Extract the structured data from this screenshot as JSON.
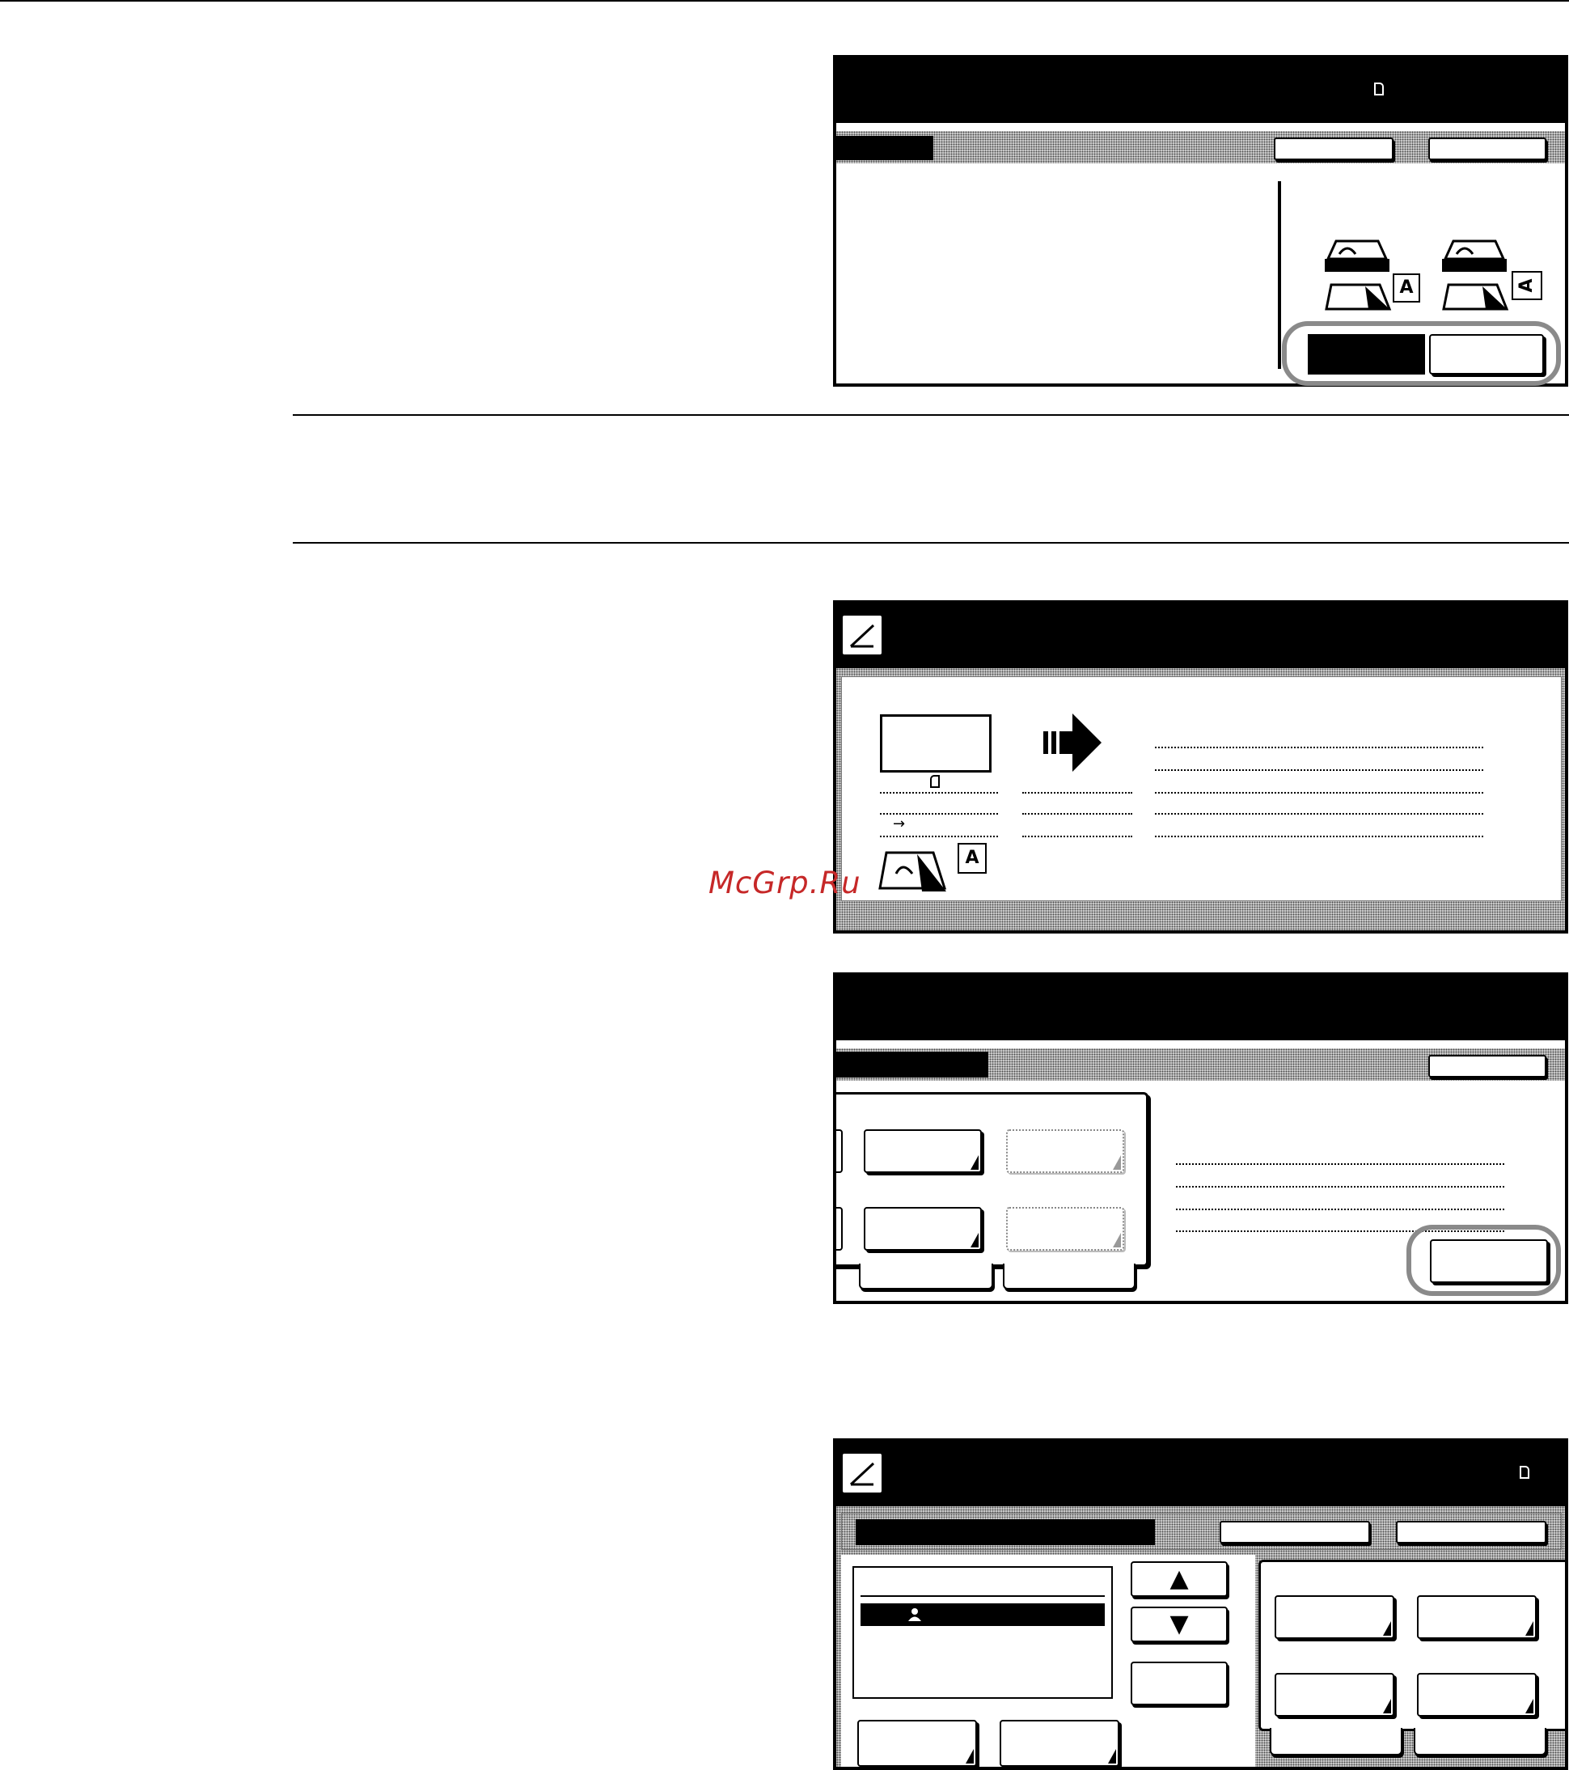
{
  "watermark": {
    "text": "McGrp.Ru"
  },
  "colors": {
    "panel_black": "#000000",
    "highlight_ring": "#8a8a8a",
    "watermark": "#c62828"
  },
  "panels": [
    {
      "id": "panel-1",
      "icons": [
        "paper-portrait-icon",
        "doc-feeder-icon-left",
        "doc-feeder-icon-right",
        "glyph-A-icon"
      ]
    },
    {
      "id": "panel-2",
      "icons": [
        "edit-icon",
        "paper-frame-icon",
        "forward-arrow-icon",
        "small-arrow-icon",
        "doc-feeder-icon",
        "glyph-A-icon"
      ]
    },
    {
      "id": "panel-3",
      "icons": [
        "button-corner-icon"
      ]
    },
    {
      "id": "panel-4",
      "icons": [
        "edit-icon",
        "paper-portrait-icon",
        "user-icon",
        "up-arrow-icon",
        "down-arrow-icon"
      ]
    }
  ],
  "glyphs": {
    "letter_a": "A",
    "up_arrow": "▲",
    "down_arrow": "▼",
    "small_arrow": "→"
  }
}
